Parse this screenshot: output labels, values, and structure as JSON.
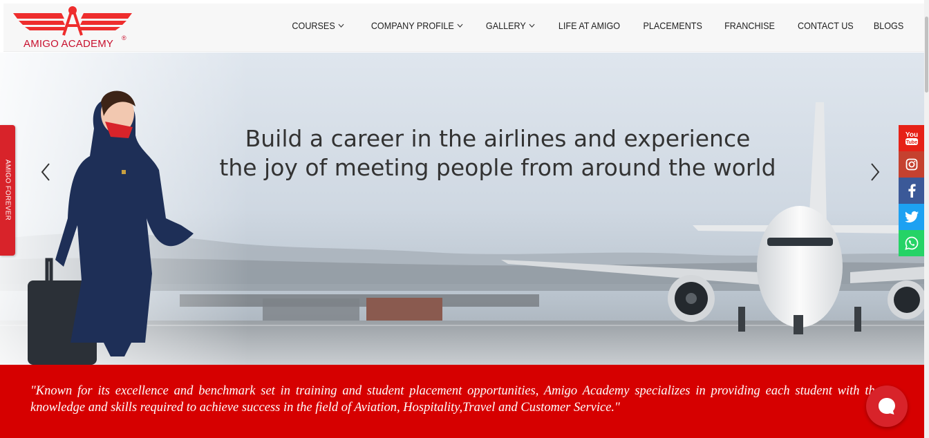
{
  "brand": {
    "name": "AMIGO ACADEMY",
    "registered": "®"
  },
  "nav": {
    "items": [
      {
        "label": "COURSES",
        "dropdown": true
      },
      {
        "label": "COMPANY PROFILE",
        "dropdown": true
      },
      {
        "label": "GALLERY",
        "dropdown": true
      },
      {
        "label": "LIFE AT AMIGO",
        "dropdown": false
      },
      {
        "label": "PLACEMENTS",
        "dropdown": false
      },
      {
        "label": "FRANCHISE",
        "dropdown": false
      },
      {
        "label": "CONTACT US",
        "dropdown": false
      },
      {
        "label": "BLOGS",
        "dropdown": false
      }
    ]
  },
  "hero": {
    "heading_line1": "Build a career in the airlines and experience",
    "heading_line2": "the joy of meeting people from around the world"
  },
  "side_tab": {
    "label": "AMIGO FOREVER"
  },
  "social": [
    {
      "icon": "youtube-icon",
      "label": "You Tube",
      "color": "#e62117"
    },
    {
      "icon": "instagram-icon",
      "color": "#c13584"
    },
    {
      "icon": "facebook-icon",
      "color": "#3b5998"
    },
    {
      "icon": "twitter-icon",
      "color": "#1da1f2"
    },
    {
      "icon": "whatsapp-icon",
      "color": "#25d366"
    }
  ],
  "quote": "\"Known for its excellence and benchmark set in training and student placement opportunities, Amigo Academy specializes in providing each student with the knowledge and skills required to achieve success in the field of Aviation, Hospitality,Travel and Customer Service.\"",
  "colors": {
    "brand_red": "#d60000",
    "logo_red": "#c8102e",
    "header_bg": "#f7f7f7"
  }
}
